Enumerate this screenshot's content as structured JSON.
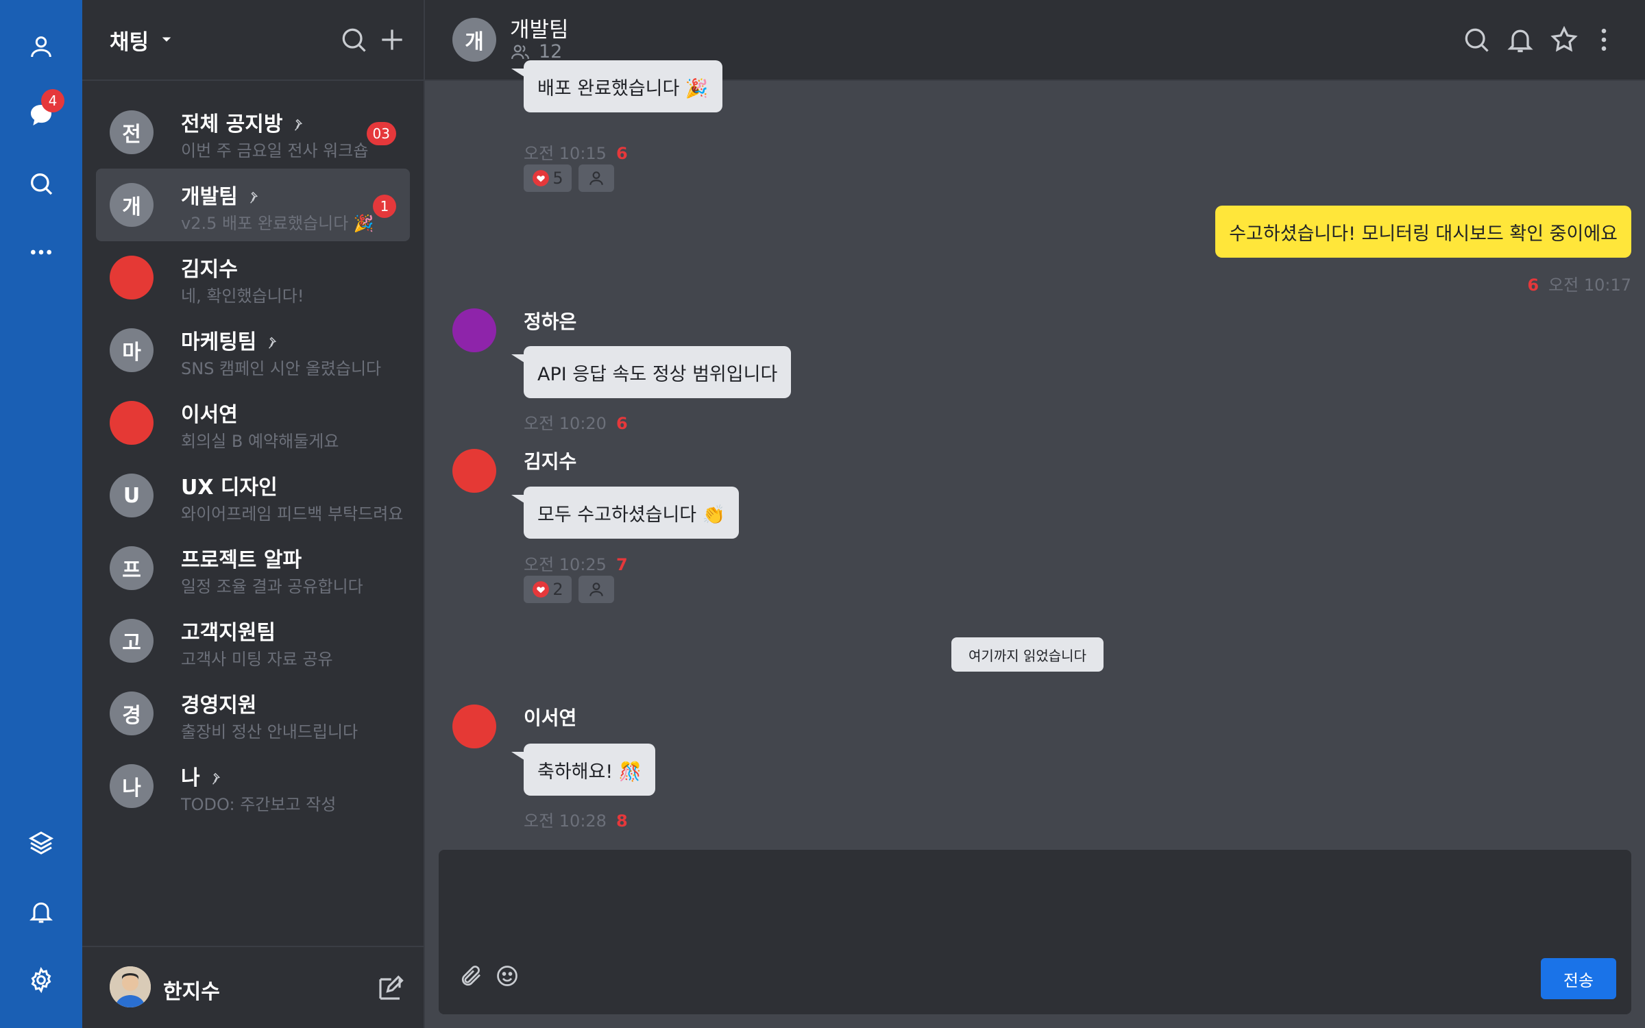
{
  "rail": {
    "chat_badge": "4",
    "icons": [
      "person-icon",
      "chat-bubble-icon",
      "search-icon",
      "more-dots-icon",
      "layers-icon",
      "bell-icon",
      "gear-icon"
    ],
    "accent_color": "#1a5fb4"
  },
  "list": {
    "title": "채팅",
    "items": [
      {
        "initial": "전",
        "name": "전체 공지방",
        "preview": "이번 주 금요일 전사 워크숍",
        "badge": "03",
        "pinned": true,
        "avatar": "gray"
      },
      {
        "initial": "개",
        "name": "개발팀",
        "preview": "v2.5 배포 완료했습니다 🎉",
        "badge": "1",
        "pinned": true,
        "avatar": "gray"
      },
      {
        "initial": "",
        "name": "김지수",
        "preview": "네, 확인했습니다!",
        "badge": "",
        "pinned": false,
        "avatar": "red"
      },
      {
        "initial": "마",
        "name": "마케팅팀",
        "preview": "SNS 캠페인 시안 올렸습니다",
        "badge": "",
        "pinned": true,
        "avatar": "gray"
      },
      {
        "initial": "",
        "name": "이서연",
        "preview": "회의실 B 예약해둘게요",
        "badge": "",
        "pinned": false,
        "avatar": "red"
      },
      {
        "initial": "U",
        "name": "UX 디자인",
        "preview": "와이어프레임 피드백 부탁드려요",
        "badge": "",
        "pinned": false,
        "avatar": "gray"
      },
      {
        "initial": "프",
        "name": "프로젝트 알파",
        "preview": "일정 조율 결과 공유합니다",
        "badge": "",
        "pinned": false,
        "avatar": "gray"
      },
      {
        "initial": "고",
        "name": "고객지원팀",
        "preview": "고객사 미팅 자료 공유",
        "badge": "",
        "pinned": false,
        "avatar": "gray"
      },
      {
        "initial": "경",
        "name": "경영지원",
        "preview": "출장비 정산 안내드립니다",
        "badge": "",
        "pinned": false,
        "avatar": "gray"
      },
      {
        "initial": "나",
        "name": "나",
        "preview": "TODO: 주간보고 작성",
        "badge": "",
        "pinned": true,
        "avatar": "gray"
      }
    ]
  },
  "profile": {
    "name": "한지수"
  },
  "room": {
    "initial": "개",
    "title": "개발팀",
    "members": "12"
  },
  "messages": {
    "m1": {
      "text": "배포 완료했습니다 🎉",
      "time": "오전 10:15",
      "unread": "6",
      "reaction_count": "5"
    },
    "m2": {
      "text": "수고하셨습니다! 모니터링 대시보드 확인 중이에요",
      "time": "오전 10:17",
      "unread": "6"
    },
    "m3": {
      "sender": "정하은",
      "text": "API 응답 속도 정상 범위입니다",
      "time": "오전 10:20",
      "unread": "6"
    },
    "m4": {
      "sender": "김지수",
      "text": "모두 수고하셨습니다 👏",
      "time": "오전 10:25",
      "unread": "7",
      "reaction_count": "2"
    },
    "divider": "여기까지 읽었습니다",
    "m5": {
      "sender": "이서연",
      "text": "축하해요! 🎊",
      "time": "오전 10:28",
      "unread": "8"
    }
  },
  "composer": {
    "placeholder": "",
    "send_label": "전송"
  },
  "colors": {
    "mine_bubble": "#ffe63a",
    "other_bubble": "#e4e6ea",
    "unread": "#e5383b",
    "send": "#1a73e8"
  }
}
